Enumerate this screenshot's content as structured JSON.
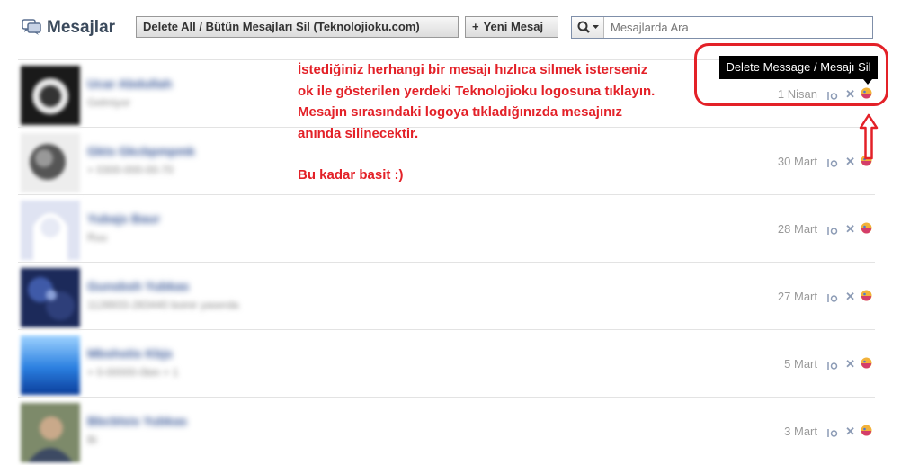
{
  "header": {
    "title": "Mesajlar",
    "delete_all_label": "Delete All / Bütün Mesajları Sil (Teknolojioku.com)",
    "new_message_plus": "+",
    "new_message_label": "Yeni Mesaj",
    "search_placeholder": "Mesajlarda Ara"
  },
  "annotation": {
    "line1": "İstediğiniz herhangi bir mesajı hızlıca silmek isterseniz",
    "line2": "ok ile gösterilen yerdeki Teknolojioku logosuna tıklayın.",
    "line3": "Mesajın sırasındaki logoya tıkladığınızda mesajınız",
    "line4": "anında silinecektir.",
    "line5": "Bu kadar basit :)"
  },
  "tooltip": {
    "text": "Delete Message / Mesajı Sil"
  },
  "messages": [
    {
      "name": "Ucar Abdullah",
      "snippet": "Gelmiyor",
      "date": "1 Nisan"
    },
    {
      "name": "Gkts Gkcbpmpmk",
      "snippet": "+ 0300-000-00-70",
      "date": "30 Mart"
    },
    {
      "name": "Yubajs Baur",
      "snippet": "Ruu",
      "date": "28 Mart"
    },
    {
      "name": "Gunsbsh Yubkas",
      "snippet": "1128933-283440 boinir yaserda",
      "date": "27 Mart"
    },
    {
      "name": "Mbshstis Kbjs",
      "snippet": "+ 0-00000-0bin = 1",
      "date": "5 Mart"
    },
    {
      "name": "Bbcblsis Yubkas",
      "snippet": "Bi",
      "date": "3 Mart"
    }
  ],
  "colors": {
    "accent_red": "#e32128",
    "link_blue": "#3b5998"
  },
  "icons": {
    "logo": "messages-icon",
    "search": "search-icon",
    "mark_read": "mark-read-icon",
    "delete": "close-icon",
    "teknolojioku": "teknolojioku-logo-icon",
    "arrow": "arrow-up-icon"
  }
}
